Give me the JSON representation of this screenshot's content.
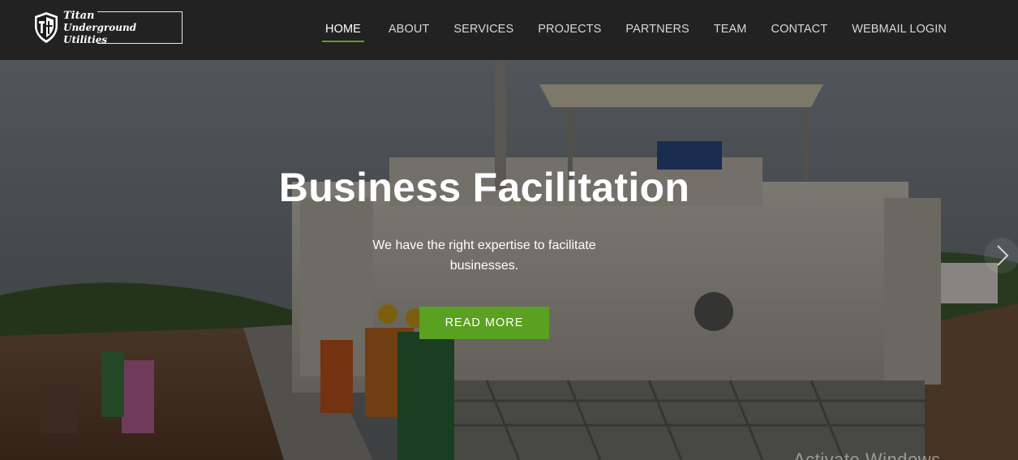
{
  "brand": {
    "line1": "Titan",
    "line2": "Underground Utilities",
    "icon": "shield-logo-icon"
  },
  "nav": {
    "items": [
      {
        "label": "HOME",
        "active": true
      },
      {
        "label": "ABOUT",
        "active": false
      },
      {
        "label": "SERVICES",
        "active": false
      },
      {
        "label": "PROJECTS",
        "active": false
      },
      {
        "label": "PARTNERS",
        "active": false
      },
      {
        "label": "TEAM",
        "active": false
      },
      {
        "label": "CONTACT",
        "active": false
      },
      {
        "label": "WEBMAIL LOGIN",
        "active": false
      }
    ]
  },
  "hero": {
    "title": "Business Facilitation",
    "subtitle": "We have the right expertise to facilitate businesses.",
    "cta_label": "READ MORE",
    "next_icon": "chevron-right-icon",
    "watermark": "Activate Windows"
  },
  "colors": {
    "header_bg": "#222222",
    "accent": "#5aa021",
    "text": "#ffffff",
    "nav_text": "#d7d7d7"
  }
}
